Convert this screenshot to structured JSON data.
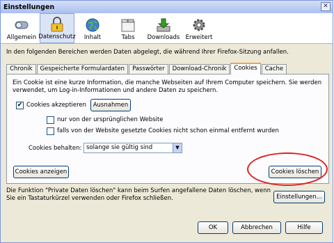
{
  "window": {
    "title": "Einstellungen",
    "close_glyph": "✕"
  },
  "toolbar": {
    "items": [
      {
        "label": "Allgemein",
        "icon": "toggle-switch-icon"
      },
      {
        "label": "Datenschutz",
        "icon": "padlock-icon"
      },
      {
        "label": "Inhalt",
        "icon": "globe-icon"
      },
      {
        "label": "Tabs",
        "icon": "tabs-icon"
      },
      {
        "label": "Downloads",
        "icon": "downloads-icon"
      },
      {
        "label": "Erweitert",
        "icon": "gear-icon"
      }
    ],
    "active": "Datenschutz"
  },
  "intro_text": "In den folgenden Bereichen werden Daten abgelegt, die während Ihrer Firefox-Sitzung anfallen.",
  "tabs": [
    "Chronik",
    "Gespeicherte Formulardaten",
    "Passwörter",
    "Download-Chronik",
    "Cookies",
    "Cache"
  ],
  "active_tab": "Cookies",
  "cookies": {
    "description": "Ein Cookie ist eine kurze Information, die manche Webseiten auf Ihrem Computer speichern. Sie werden verwendet, um Log-in-Informationen und andere Daten zu speichern.",
    "accept_label": "Cookies akzeptieren",
    "accept_checked": true,
    "exceptions_button": "Ausnahmen",
    "origin_only_label": "nur von der ursprünglichen Website",
    "origin_only_checked": false,
    "unless_removed_label": "falls von der Website gesetzte Cookies nicht schon einmal entfernt wurden",
    "unless_removed_checked": false,
    "keep_label": "Cookies behalten:",
    "keep_value": "solange sie gültig sind",
    "show_button": "Cookies anzeigen",
    "clear_button": "Cookies löschen"
  },
  "private_data": {
    "text": "Die Funktion \"Private Daten löschen\" kann beim Surfen angefallene Daten löschen, wenn Sie ein Tastaturkürzel verwenden oder Firefox schließen.",
    "settings_button": "Einstellungen..."
  },
  "dialog_buttons": {
    "ok": "OK",
    "cancel": "Abbrechen",
    "help": "Hilfe"
  },
  "colors": {
    "highlight_ring": "#e02020",
    "active_tab_accent": "#e8a54a",
    "toolbar_active": "#dbe4f5"
  }
}
